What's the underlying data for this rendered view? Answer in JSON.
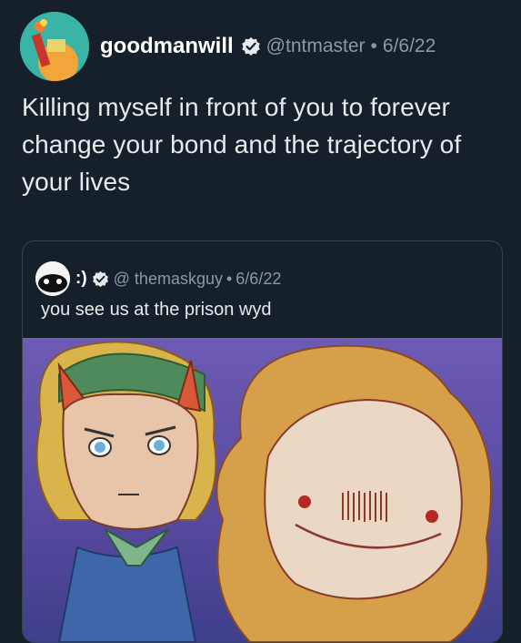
{
  "tweet": {
    "display_name": "goodmanwill",
    "handle": "@tntmaster",
    "separator": "•",
    "date": "6/6/22",
    "text": "Killing myself in front of you to forever change your bond and the trajectory of your lives",
    "verified_icon": "verified-badge-icon"
  },
  "quote": {
    "display_name": ":)",
    "handle": "@ themaskguy",
    "separator": "•",
    "date": "6/6/22",
    "text": "you see us at the prison wyd",
    "verified_icon": "verified-badge-icon"
  },
  "colors": {
    "background": "#15202b",
    "border": "#38444d",
    "muted_text": "#8b98a5"
  }
}
